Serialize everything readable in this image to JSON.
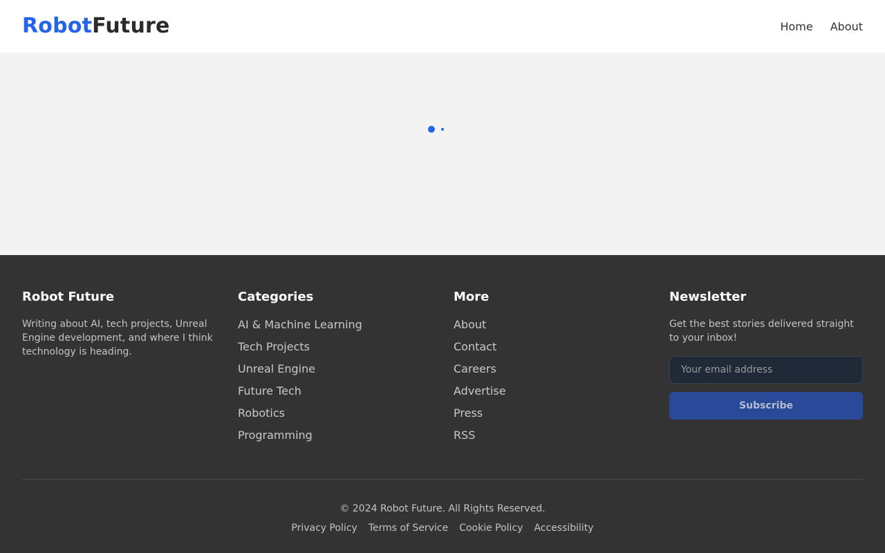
{
  "header": {
    "logo_part1": "Robot",
    "logo_part2": "Future",
    "nav": [
      {
        "label": "Home"
      },
      {
        "label": "About"
      }
    ]
  },
  "main": {
    "loading_indicator": "loading-dots"
  },
  "footer": {
    "about": {
      "title": "Robot Future",
      "text": "Writing about AI, tech projects, Unreal Engine development, and where I think technology is heading."
    },
    "categories": {
      "title": "Categories",
      "items": [
        "AI & Machine Learning",
        "Tech Projects",
        "Unreal Engine",
        "Future Tech",
        "Robotics",
        "Programming"
      ]
    },
    "more": {
      "title": "More",
      "items": [
        "About",
        "Contact",
        "Careers",
        "Advertise",
        "Press",
        "RSS"
      ]
    },
    "newsletter": {
      "title": "Newsletter",
      "text": "Get the best stories delivered straight to your inbox!",
      "email_placeholder": "Your email address",
      "email_value": "",
      "subscribe_label": "Subscribe"
    },
    "copyright": "© 2024 Robot Future. All Rights Reserved.",
    "legal_links": [
      "Privacy Policy",
      "Terms of Service",
      "Cookie Policy",
      "Accessibility"
    ]
  },
  "colors": {
    "accent": "#2563eb",
    "footer_bg": "#333333",
    "page_bg": "#f3f3f3"
  }
}
